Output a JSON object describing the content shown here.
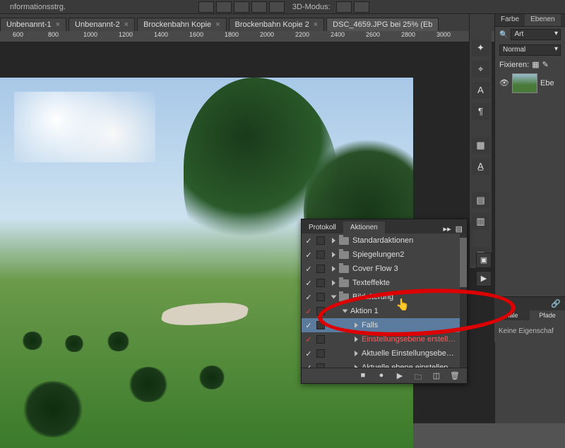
{
  "topbar": {
    "label": "3D-Modus:"
  },
  "tabs": [
    {
      "label": "Unbenannt-1"
    },
    {
      "label": "Unbenannt-2"
    },
    {
      "label": "Brockenbahn Kopie"
    },
    {
      "label": "Brockenbahn Kopie 2"
    },
    {
      "label": "DSC_4659.JPG bei 25% (Eb",
      "active": true
    }
  ],
  "ruler": [
    "600",
    "800",
    "1000",
    "1200",
    "1400",
    "1600",
    "1800",
    "2000",
    "2200",
    "2400",
    "2600",
    "2800",
    "3000"
  ],
  "panels": {
    "color_tab": "Farbe",
    "layers_tab": "Ebenen",
    "art_label": "Art",
    "mode": "Normal",
    "fix_label": "Fixieren:",
    "layer_name": "Ebe",
    "channels_tab": "näle",
    "paths_tab": "Pfade",
    "no_props": "Keine Eigenschaf"
  },
  "actions": {
    "tab_protocol": "Protokoll",
    "tab_actions": "Aktionen",
    "items": [
      {
        "label": "Standardaktionen",
        "folder": true,
        "indent": 0,
        "check": true
      },
      {
        "label": "Spiegelungen2",
        "folder": true,
        "indent": 0,
        "check": true
      },
      {
        "label": "Cover Flow 3",
        "folder": true,
        "indent": 0,
        "check": true
      },
      {
        "label": "Texteffekte",
        "folder": true,
        "indent": 0,
        "check": true
      },
      {
        "label": "Bildalterung",
        "folder": true,
        "indent": 0,
        "check": true,
        "open": true
      },
      {
        "label": "Aktion 1",
        "folder": false,
        "indent": 1,
        "check": true,
        "open": true,
        "red": true
      },
      {
        "label": "Falls",
        "folder": false,
        "indent": 2,
        "check": true,
        "sel": true
      },
      {
        "label": "Einstellungsebene erstell…",
        "folder": false,
        "indent": 2,
        "check": true,
        "redtext": true
      },
      {
        "label": "Aktuelle Einstellungsebe…",
        "folder": false,
        "indent": 2,
        "check": true
      },
      {
        "label": "Aktuelle ebene einstellen",
        "folder": false,
        "indent": 2,
        "check": true
      }
    ]
  }
}
